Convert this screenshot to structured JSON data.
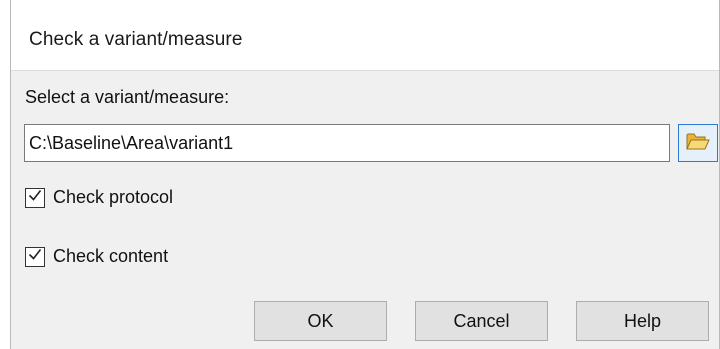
{
  "dialog": {
    "title": "Check a variant/measure",
    "prompt_label": "Select a variant/measure:",
    "path_value": "C:\\Baseline\\Area\\variant1",
    "browse_icon": "folder-open-icon",
    "options": [
      {
        "label": "Check protocol",
        "checked": true
      },
      {
        "label": "Check content",
        "checked": true
      }
    ],
    "buttons": {
      "ok": "OK",
      "cancel": "Cancel",
      "help": "Help"
    }
  },
  "colors": {
    "title_background": "#ffffff",
    "body_background": "#f0f0f0",
    "browse_border": "#2f79d6",
    "folder_yellow": "#f2c94c"
  }
}
